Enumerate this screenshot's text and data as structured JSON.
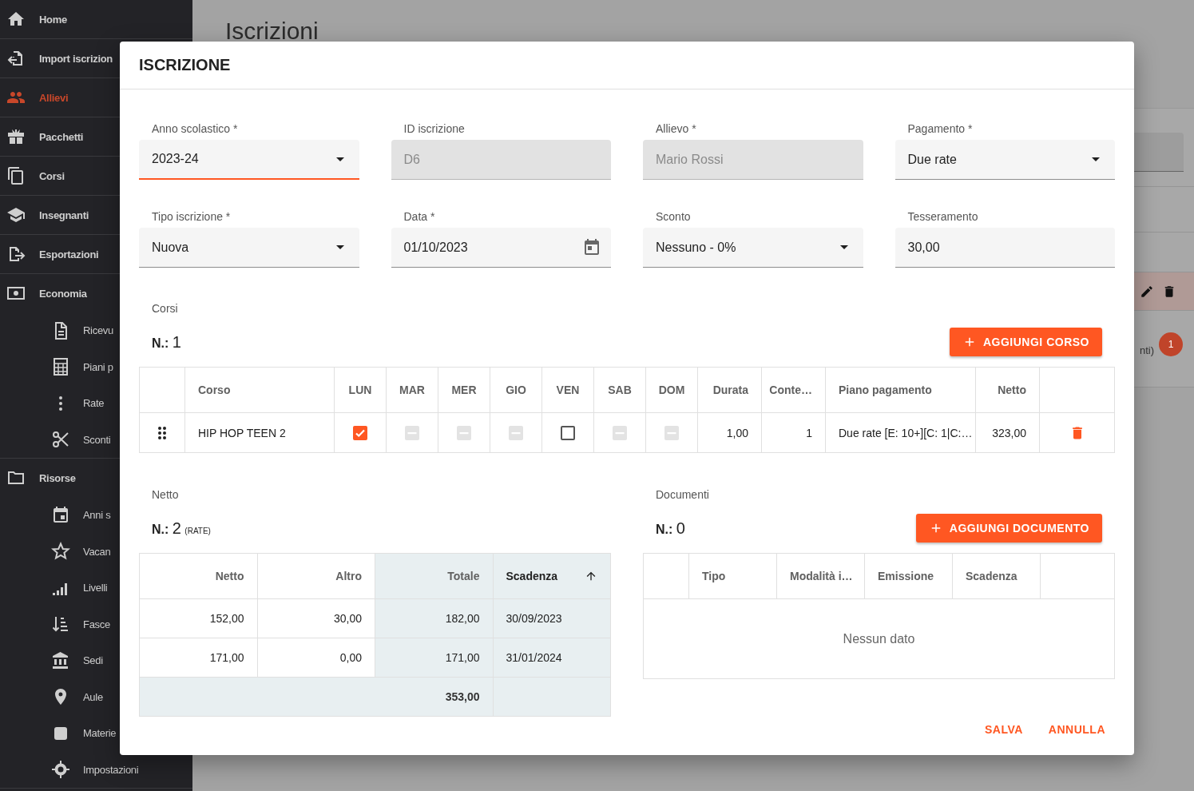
{
  "sidebar": {
    "items": [
      {
        "label": "Home",
        "selected": false
      },
      {
        "label": "Import iscrizion",
        "selected": false
      },
      {
        "label": "Allievi",
        "selected": true
      },
      {
        "label": "Pacchetti",
        "selected": false
      },
      {
        "label": "Corsi",
        "selected": false
      },
      {
        "label": "Insegnanti",
        "selected": false
      },
      {
        "label": "Esportazioni",
        "selected": false
      },
      {
        "label": "Economia",
        "selected": false,
        "children": [
          {
            "label": "Ricevu",
            "selected": false
          },
          {
            "label": "Piani p",
            "selected": false
          },
          {
            "label": "Rate",
            "selected": false
          },
          {
            "label": "Sconti",
            "selected": false
          }
        ]
      },
      {
        "label": "Risorse",
        "selected": false,
        "children": [
          {
            "label": "Anni s",
            "selected": false
          },
          {
            "label": "Vacan",
            "selected": false
          },
          {
            "label": "Livelli",
            "selected": false
          },
          {
            "label": "Fasce",
            "selected": false
          },
          {
            "label": "Sedi",
            "selected": false
          },
          {
            "label": "Aule",
            "selected": false
          },
          {
            "label": "Materie",
            "selected": false
          },
          {
            "label": "Impostazioni",
            "selected": false
          }
        ]
      }
    ]
  },
  "page": {
    "title": "Iscrizioni",
    "row_text": "nti)",
    "badge": "1"
  },
  "dialog": {
    "title": "ISCRIZIONE",
    "fields": [
      {
        "label": "Anno scolastico *",
        "value": "2023-24",
        "kind": "select",
        "focused": true,
        "disabled": false
      },
      {
        "label": "ID iscrizione",
        "value": "D6",
        "kind": "text",
        "focused": false,
        "disabled": true
      },
      {
        "label": "Allievo *",
        "value": "Mario Rossi",
        "kind": "text",
        "focused": false,
        "disabled": true
      },
      {
        "label": "Pagamento *",
        "value": "Due rate",
        "kind": "select",
        "focused": false,
        "disabled": false
      },
      {
        "label": "Tipo iscrizione *",
        "value": "Nuova",
        "kind": "select",
        "focused": false,
        "disabled": false
      },
      {
        "label": "Data *",
        "value": "01/10/2023",
        "kind": "date",
        "focused": false,
        "disabled": false
      },
      {
        "label": "Sconto",
        "value": "Nessuno - 0%",
        "kind": "select",
        "focused": false,
        "disabled": false
      },
      {
        "label": "Tesseramento",
        "value": "30,00",
        "kind": "text",
        "focused": false,
        "disabled": false
      }
    ],
    "courses": {
      "label": "Corsi",
      "count_label": "N.:",
      "count": "1",
      "add_button": "AGGIUNGI CORSO",
      "columns": [
        {
          "label": "Corso",
          "kind": "text"
        },
        {
          "label": "LUN",
          "kind": "day"
        },
        {
          "label": "MAR",
          "kind": "day"
        },
        {
          "label": "MER",
          "kind": "day"
        },
        {
          "label": "GIO",
          "kind": "day"
        },
        {
          "label": "VEN",
          "kind": "day"
        },
        {
          "label": "SAB",
          "kind": "day"
        },
        {
          "label": "DOM",
          "kind": "day"
        },
        {
          "label": "Durata",
          "kind": "number"
        },
        {
          "label": "Conte…",
          "kind": "number"
        },
        {
          "label": "Piano pagamento",
          "kind": "text"
        },
        {
          "label": "Netto",
          "kind": "number"
        }
      ],
      "rows": [
        {
          "course": "HIP HOP TEEN 2",
          "days": [
            {
              "checked": true,
              "disabled": false
            },
            {
              "checked": false,
              "disabled": true
            },
            {
              "checked": false,
              "disabled": true
            },
            {
              "checked": false,
              "disabled": true
            },
            {
              "checked": false,
              "disabled": false
            },
            {
              "checked": false,
              "disabled": true
            },
            {
              "checked": false,
              "disabled": true
            }
          ],
          "values": [
            "1,00",
            "1",
            "Due rate [E: 10+][C: 1|C:…",
            "323,00"
          ]
        }
      ]
    },
    "rates": {
      "label": "Netto",
      "count_label": "N.:",
      "count": "2",
      "count_note": "(RATE)",
      "columns": [
        {
          "label": "Netto",
          "kind": "number",
          "highlighted": false,
          "sorted": false
        },
        {
          "label": "Altro",
          "kind": "number",
          "highlighted": false,
          "sorted": false
        },
        {
          "label": "Totale",
          "kind": "number",
          "highlighted": true,
          "sorted": false
        },
        {
          "label": "Scadenza",
          "kind": "date",
          "highlighted": true,
          "sorted": true
        }
      ],
      "rows": [
        [
          "152,00",
          "30,00",
          "182,00",
          "30/09/2023"
        ],
        [
          "171,00",
          "0,00",
          "171,00",
          "31/01/2024"
        ]
      ],
      "total": "353,00"
    },
    "documents": {
      "label": "Documenti",
      "count_label": "N.:",
      "count": "0",
      "add_button": "AGGIUNGI DOCUMENTO",
      "columns": [
        "Tipo",
        "Modalità i…",
        "Emissione",
        "Scadenza"
      ],
      "empty_text": "Nessun dato"
    },
    "actions": [
      "SALVA",
      "ANNULLA"
    ]
  }
}
